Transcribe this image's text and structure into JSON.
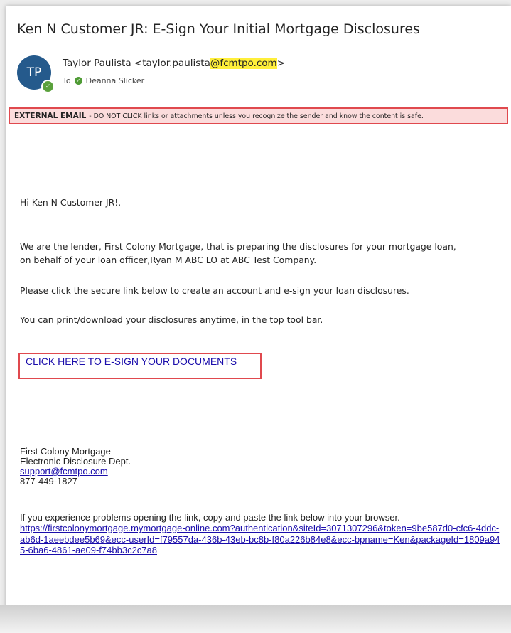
{
  "email": {
    "subject": "Ken N Customer JR: E-Sign Your Initial Mortgage Disclosures",
    "sender": {
      "initials": "TP",
      "name_prefix": "Taylor Paulista <taylor.paulista",
      "domain_highlighted": "@fcmtpo.com",
      "suffix": ">"
    },
    "recipients": {
      "to_label": "To",
      "name": "Deanna Slicker"
    },
    "banner": {
      "title": "EXTERNAL EMAIL",
      "text": "- DO NOT CLICK links or attachments unless you recognize the sender and know the content is safe."
    },
    "body": {
      "greeting": "Hi Ken N Customer JR!,",
      "para1_line1": "We are the lender, First Colony Mortgage, that is preparing the disclosures for your mortgage loan,",
      "para1_line2": "on behalf of your loan officer,Ryan M ABC LO at ABC Test Company.",
      "para2": "Please click the secure link below to create an account and e-sign your loan disclosures.",
      "para3": "You can print/download your disclosures anytime, in the top tool bar.",
      "cta": "CLICK HERE TO E-SIGN YOUR DOCUMENTS"
    },
    "signature": {
      "company": "First Colony Mortgage",
      "dept": "Electronic Disclosure Dept.",
      "email": "support@fcmtpo.com",
      "phone": "877-449-1827"
    },
    "footer": {
      "note": "If you experience problems opening the link, copy and paste the link below into your browser.",
      "link": "https://firstcolonymortgage.mymortgage-online.com?authentication&siteId=3071307296&token=9be587d0-cfc6-4ddc-ab6d-1aeebdee5b69&ecc-userId=f79557da-436b-43eb-bc8b-f80a226b84e8&ecc-bpname=Ken&packageId=1809a945-6ba6-4861-ae09-f74bb3c2c7a8"
    }
  },
  "colors": {
    "avatar_bg": "#255a8c",
    "banner_bg": "#fbdcdc",
    "banner_border": "#e0494e",
    "highlight": "#ffef3a",
    "link": "#1a0dab"
  }
}
